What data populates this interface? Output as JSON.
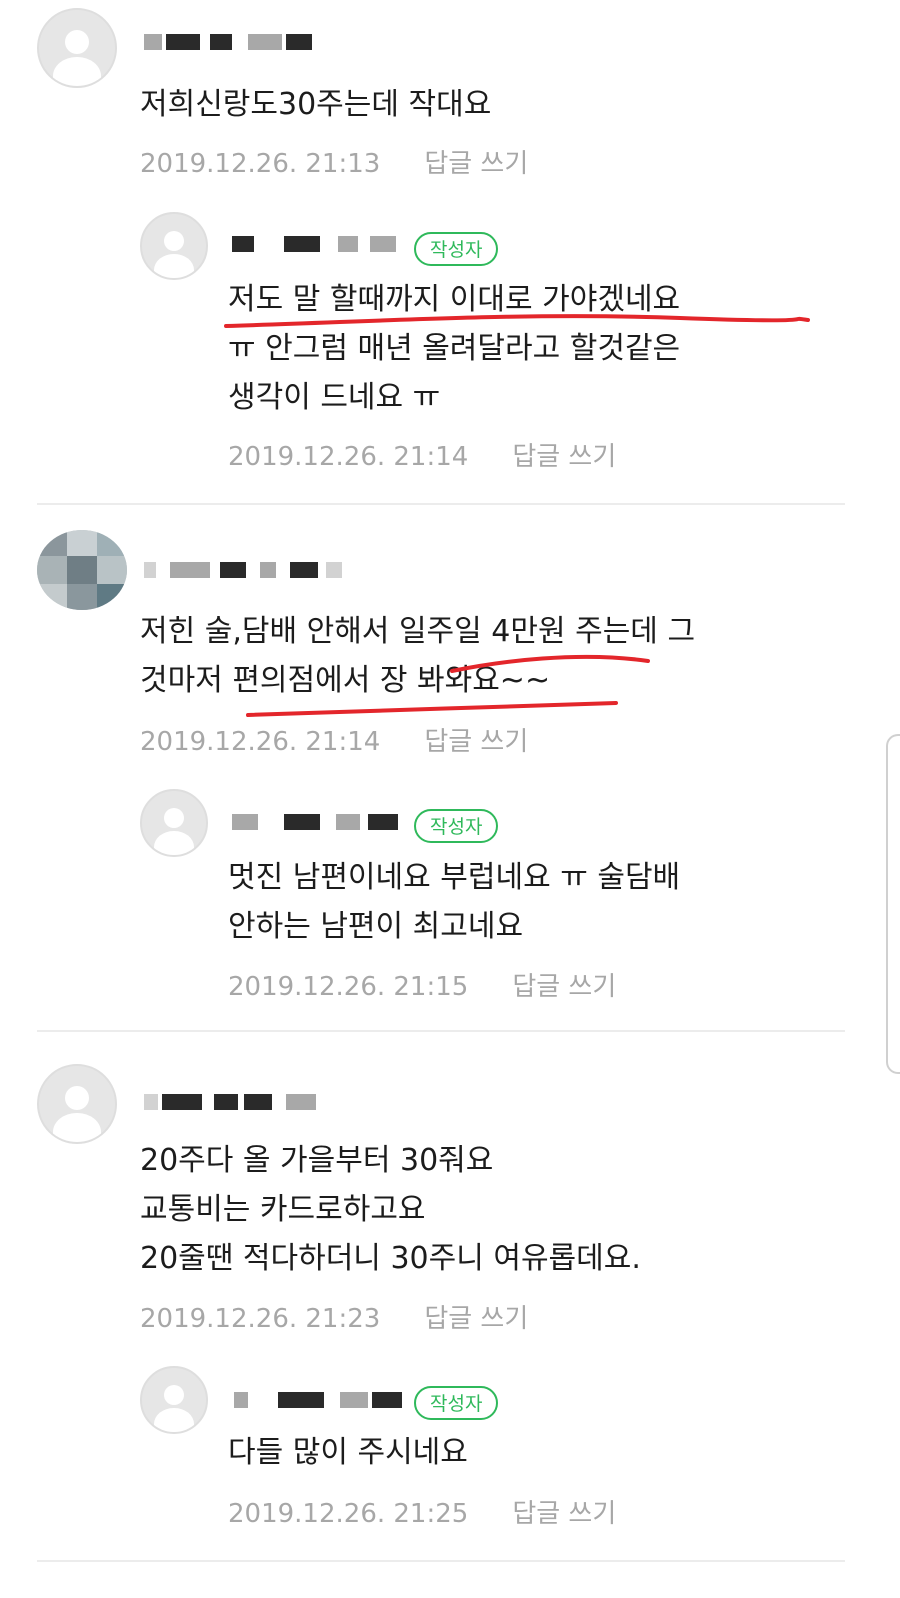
{
  "author_badge": "작성자",
  "reply_label": "답글 쓰기",
  "comments": [
    {
      "text": "저희신랑도30주는데 작대요",
      "time": "2019.12.26. 21:13"
    },
    {
      "text": "저도 말 할때까지 이대로 가야겠네요\nㅠ 안그럼 매년 올려달라고 할것같은\n생각이 드네요 ㅠ",
      "time": "2019.12.26. 21:14"
    },
    {
      "text": "저힌 술,담배 안해서 일주일 4만원 주는데 그\n것마저 편의점에서 장 봐와요~~",
      "time": "2019.12.26. 21:14"
    },
    {
      "text": "멋진 남편이네요 부럽네요 ㅠ 술담배\n안하는 남편이 최고네요",
      "time": "2019.12.26. 21:15"
    },
    {
      "text": "20주다 올 가을부터 30줘요\n교통비는 카드로하고요\n20줄땐 적다하더니 30주니 여유롭데요.",
      "time": "2019.12.26. 21:23"
    },
    {
      "text": "다들 많이 주시네요",
      "time": "2019.12.26. 21:25"
    }
  ],
  "colors": {
    "badge": "#2fb95b",
    "meta": "#a7a7a7",
    "annotation": "#e3262b"
  }
}
